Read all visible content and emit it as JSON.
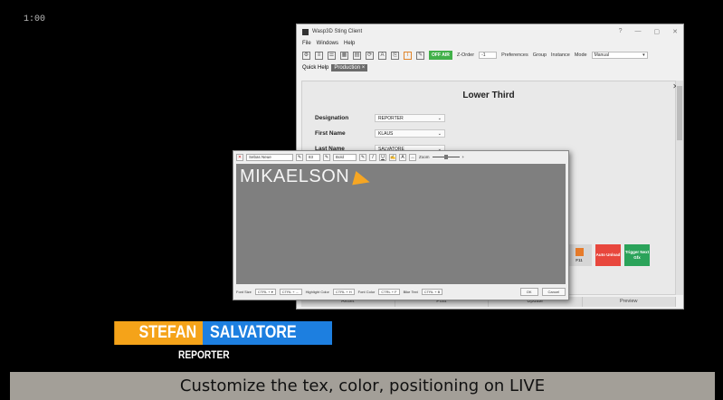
{
  "timecode": "1:00",
  "app": {
    "title": "Wasp3D Sting Client",
    "menu": [
      "File",
      "Windows",
      "Help"
    ],
    "toolbar": {
      "off_air": "OFF AIR",
      "zorder_label": "Z-Order",
      "zorder_value": "-1",
      "preferences": "Preferences",
      "group": "Group",
      "instance": "Instance",
      "mode_label": "Mode",
      "mode_value": "Manual"
    },
    "tabs": [
      "Quick Help",
      "Production"
    ],
    "form": {
      "title": "Lower Third",
      "designation_label": "Designation",
      "designation_value": "REPORTER",
      "first_name_label": "First Name",
      "first_name_value": "KLAUS",
      "last_name_label": "Last Name",
      "last_name_value": "SALVATORE"
    },
    "actions": {
      "f11": "F11",
      "auto_unload": "Auto Unload",
      "trigger": "Trigger Next Gfx"
    },
    "bottom_buttons": [
      "Reset",
      "Post",
      "Update",
      "Preview"
    ]
  },
  "editor": {
    "font": "Sebas Neue",
    "size": "83",
    "weight": "Bold",
    "zoom_label": "Zoom",
    "text": "MIKAELSON",
    "footer": {
      "font_size": "Font Size",
      "highlight": "Highlight Color",
      "font_color": "Font Color",
      "bike_text": "Bike Text",
      "ok": "OK",
      "cancel": "Cancel"
    }
  },
  "lower_third": {
    "first": "STEFAN",
    "last": "SALVATORE",
    "role": "REPORTER"
  },
  "caption": "Customize the tex, color, positioning on LIVE",
  "colors": {
    "accent_orange": "#f5a319",
    "accent_blue": "#1d7fe0",
    "off_air_green": "#41b049"
  }
}
